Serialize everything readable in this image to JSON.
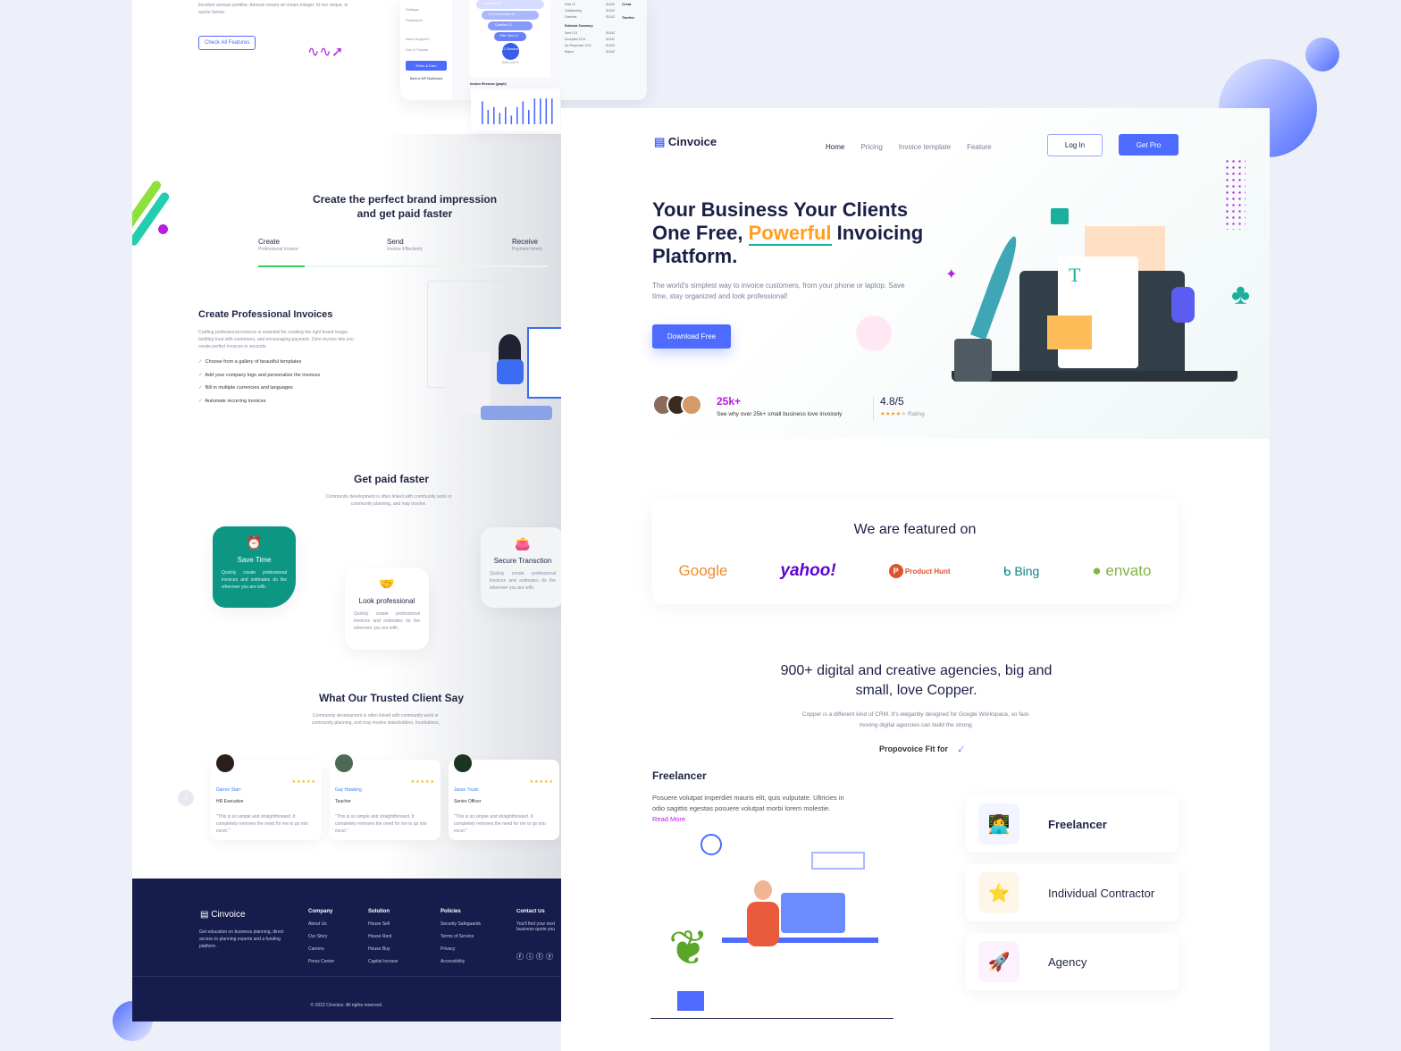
{
  "colors": {
    "accent": "#4d6bff",
    "teal": "#0e9684",
    "orange": "#ff9f1c",
    "purple": "#b620e0",
    "footer": "#161d4d"
  },
  "left": {
    "intro_text": "tincidunt aenean porttitor. Aenean ornare sit ornare integer. Id nec neque, in auctor fames.",
    "check_features": "Check All Features",
    "dashboard": {
      "menu": [
        "Settings",
        "Profession",
        "Need Support?",
        "Doc & Tutorial"
      ],
      "refer": "Refer & Earn",
      "back": "Back to WP Dashboard",
      "funnel": [
        "Interested 12",
        "In Conversation 12",
        "Qualified 12",
        "Offer Sent 12"
      ],
      "funnel_end": "12 Overdue",
      "deal_lost": "Deal Lost: 8",
      "invoice_rows": [
        [
          "Paid 12",
          "$1342"
        ],
        [
          "Outstanding",
          "$1342"
        ],
        [
          "Overdue",
          "$1342"
        ]
      ],
      "estimate_title": "Estimate Summary",
      "estimate_rows": [
        [
          "Sent 213",
          "$1342"
        ],
        [
          "Accepted 1214",
          "$1342"
        ],
        [
          "No Response 1221",
          "$1342"
        ],
        [
          "Reject",
          "$1342"
        ]
      ],
      "timeline": "Timeline",
      "create": "Creat",
      "graph_title": "Invoice Revenue (graph)",
      "graph_values": [
        8,
        5,
        6,
        4,
        6,
        3,
        6,
        8,
        5,
        9,
        9,
        9,
        9
      ]
    },
    "brand_title": "Create the perfect brand impression and get paid faster",
    "steps": [
      {
        "t": "Create",
        "s": "Professional Invoice"
      },
      {
        "t": "Send",
        "s": "Invoice Effectively"
      },
      {
        "t": "Receive",
        "s": "Payment timely"
      }
    ],
    "step_progress": 0.16,
    "prof_title": "Create Professional Invoices",
    "prof_text": "Crafting professional invoices is essential for creating the right brand image, building trust with customers, and encouraging payment. Zoho Invoice lets you create perfect invoices in seconds.",
    "checks": [
      "Choose from a gallery of beautiful templates",
      "Add your company logo and personalize the invoices",
      "Bill in multiple currencies and languages",
      "Automate recurring invoices"
    ],
    "paid_title": "Get paid faster",
    "paid_text": "Community development is often linked with community work or community planning, and may involve.",
    "features": [
      {
        "t": "Save Time",
        "d": "Quickly create professional invoices and estimates do the wherever you are with."
      },
      {
        "t": "Look professional",
        "d": "Quickly create professional invoices and estimates do the wherever you are with."
      },
      {
        "t": "Secure Transction",
        "d": "Quickly create professional invoices and estimates do the wherever you are with."
      }
    ],
    "client_title": "What Our Trusted Client Say",
    "client_text": "Community development is often linked with community work or community planning, and may involve stakeholders, foundations,",
    "testimonials": [
      {
        "n": "Darren Starr",
        "r": "HR Executive"
      },
      {
        "n": "Gay Hawking",
        "r": "Teacher"
      },
      {
        "n": "Jason Trudo",
        "r": "Senior Officer"
      }
    ],
    "stars": "★★★★★",
    "quote": "\"This is so simple and straightforward. It completely removes the need for me to go into excel.\"",
    "footer": {
      "brand": "Cinvoice",
      "about": "Get education on business planning, direct access to planning experts and a funding platform .",
      "cols": [
        {
          "h": "Company",
          "l": [
            "About Us",
            "Our Story",
            "Careers",
            "Press Center"
          ]
        },
        {
          "h": "Solution",
          "l": [
            "House Sell",
            "House Rent",
            "House Buy",
            "Capital Incrase"
          ]
        },
        {
          "h": "Policies",
          "l": [
            "Security Safeguards",
            "Terms of Service",
            "Privacy",
            "Accessibility"
          ]
        }
      ],
      "contact": "Contact Us",
      "contact_text": "You'll find your next business quote you",
      "copyright": "© 2022 Cinvoice. All rights reserved."
    }
  },
  "right": {
    "brand": "Cinvoice",
    "nav": [
      "Home",
      "Pricing",
      "Invoice template",
      "Feature"
    ],
    "login": "Log In",
    "getpro": "Get Pro",
    "title_1": "Your Business Your Clients",
    "title_2a": "One Free, ",
    "title_2b": "Powerful",
    "title_2c": " Invoicing",
    "title_3": "Platform.",
    "subtitle": "The world's simplest way to invoice customers, from your phone or laptop. Save time, stay organized and look professional!",
    "download": "Download Free",
    "users_count": "25k+",
    "users_text": "See why over 25k+ small business love invoicely",
    "rating": "4.8/5",
    "rating_stars": "★★★★",
    "rating_empty": "★",
    "rating_label": "Rating",
    "rating_value": 4.8,
    "featured_title": "We are featured on",
    "logos": [
      "Google",
      "yahoo!",
      "Product Hunt",
      "Bing",
      "envato"
    ],
    "agencies_title": "900+ digital and creative agencies, big and small, love Copper.",
    "agencies_text": "Copper is a different kind of CRM. It's elegantly designed for Google Workspace, so fast-moving digital agencies can build the strong.",
    "fit_for": "Propovoice Fit for",
    "freelancer_title": "Freelancer",
    "freelancer_text": "Posuere volutpat imperdiet mauris elit, quis vulputate. Ultricies in odio sagittis egestas posuere volutpat morbi lorem molestie. ",
    "read_more": "Read More",
    "fits": [
      {
        "l": "Freelancer",
        "i": "👩‍💻"
      },
      {
        "l": "Individual Contractor",
        "i": "⭐"
      },
      {
        "l": "Agency",
        "i": "🚀"
      }
    ]
  }
}
